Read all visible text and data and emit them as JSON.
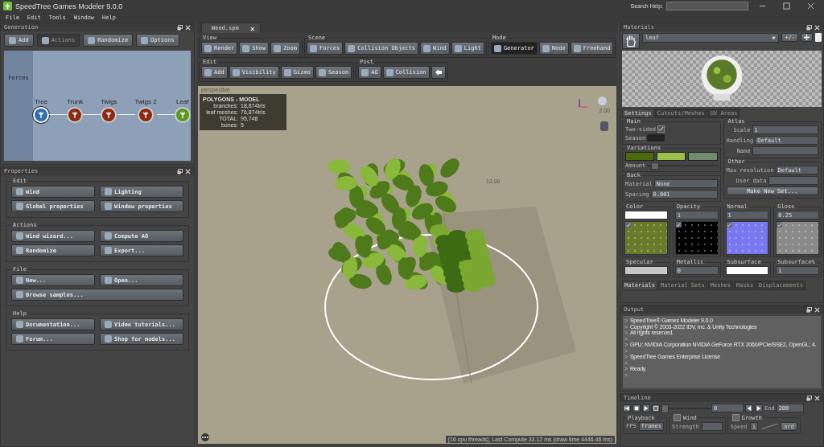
{
  "window": {
    "title": "SpeedTree Games Modeler 9.0.0",
    "search_label": "Search Help:"
  },
  "menu": [
    "File",
    "Edit",
    "Tools",
    "Window",
    "Help"
  ],
  "generation": {
    "title": "Generation",
    "toolbar": [
      {
        "label": "Add",
        "disabled": false
      },
      {
        "label": "Actions",
        "disabled": true
      },
      {
        "label": "Randomize",
        "disabled": false
      },
      {
        "label": "Options",
        "disabled": false
      }
    ],
    "side_label": "Forces",
    "nodes": [
      {
        "label": "Tree",
        "kind": "tree",
        "selected": true
      },
      {
        "label": "Trunk",
        "kind": "branch",
        "selected": false
      },
      {
        "label": "Twigs",
        "kind": "branch",
        "selected": false
      },
      {
        "label": "Twigs 2",
        "kind": "branch",
        "selected": false
      },
      {
        "label": "Leaf",
        "kind": "leaf",
        "selected": false
      }
    ]
  },
  "properties": {
    "title": "Properties",
    "groups": [
      {
        "title": "Edit",
        "buttons": [
          {
            "label": "Wind",
            "wide": false
          },
          {
            "label": "Lighting",
            "wide": false
          },
          {
            "label": "Global properties",
            "wide": false
          },
          {
            "label": "Window properties",
            "wide": false
          }
        ]
      },
      {
        "title": "Actions",
        "buttons": [
          {
            "label": "Wind wizard...",
            "wide": false
          },
          {
            "label": "Compute AO",
            "wide": false
          },
          {
            "label": "Randomize",
            "wide": false
          },
          {
            "label": "Export...",
            "wide": false
          }
        ]
      },
      {
        "title": "File",
        "buttons": [
          {
            "label": "New...",
            "wide": false
          },
          {
            "label": "Open...",
            "wide": false
          },
          {
            "label": "Browse samples...",
            "wide": true
          }
        ]
      },
      {
        "title": "Help",
        "buttons": [
          {
            "label": "Documentation...",
            "wide": false
          },
          {
            "label": "Video tutorials...",
            "wide": false
          },
          {
            "label": "Forum...",
            "wide": false
          },
          {
            "label": "Shop for models...",
            "wide": false
          }
        ]
      }
    ]
  },
  "document_tab": {
    "label": "Weed.spm",
    "close": "✕"
  },
  "toolbar": {
    "rows": [
      [
        {
          "title": "View",
          "buttons": [
            {
              "kind": "label",
              "label": "Render"
            },
            {
              "kind": "label",
              "label": "Show"
            },
            {
              "kind": "label",
              "label": "Zoom"
            }
          ]
        },
        {
          "title": "Scene",
          "buttons": [
            {
              "kind": "label",
              "label": "Forces"
            },
            {
              "kind": "label",
              "label": "Collision Objects"
            },
            {
              "kind": "label",
              "label": "Wind"
            },
            {
              "kind": "label",
              "label": "Light"
            }
          ]
        },
        {
          "title": "Mode",
          "buttons": [
            {
              "kind": "label",
              "label": "Generator",
              "selected": true
            },
            {
              "kind": "label",
              "label": "Node",
              "selected": false
            },
            {
              "kind": "label",
              "label": "Freehand",
              "selected": false
            }
          ]
        }
      ],
      [
        {
          "title": "Edit",
          "buttons": [
            {
              "kind": "label",
              "label": "Add"
            },
            {
              "kind": "label",
              "label": "Visibility"
            },
            {
              "kind": "label",
              "label": "Gizmo"
            },
            {
              "kind": "label",
              "label": "Season"
            }
          ]
        },
        {
          "title": "Post",
          "buttons": [
            {
              "kind": "label",
              "label": "AO"
            },
            {
              "kind": "label",
              "label": "Collision"
            },
            {
              "kind": "arrow"
            }
          ]
        }
      ]
    ]
  },
  "viewport": {
    "label": "perspective",
    "stats": {
      "title": "POLYGONS - MODEL",
      "rows": [
        {
          "label": "branches:",
          "value": "18,874",
          "unit": "tris"
        },
        {
          "label": "leaf meshes:",
          "value": "76,874",
          "unit": "tris"
        },
        {
          "label": "TOTAL:",
          "value": "95,748"
        },
        {
          "label": "bones:",
          "value": "5"
        }
      ]
    },
    "scale_label": "12.00",
    "camera_label": "2.00",
    "status": "[16 cpu threads], Last Compute 33.12 ms (draw time 4446.46 ms)"
  },
  "materials": {
    "title": "Materials",
    "material": "leaf",
    "plus_minus": "+/-",
    "tabs": [
      {
        "label": "Settings",
        "selected": true
      },
      {
        "label": "Cutouts/Meshes",
        "selected": false
      },
      {
        "label": "UV Areas",
        "selected": false
      }
    ],
    "main": {
      "title": "Main",
      "two_sided_label": "Two-sided",
      "two_sided": true,
      "season_label": "Season"
    },
    "variations": {
      "title": "Variations",
      "swatches": [
        {
          "color": "#4a6b0c"
        },
        {
          "color": "#9cc04a"
        },
        {
          "color": "#6f8c6c"
        }
      ],
      "amount_label": "Amount",
      "level": 0.05
    },
    "back": {
      "title": "Back",
      "material_label": "Material",
      "material": "None",
      "spacing_label": "Spacing",
      "spacing": "0.001"
    },
    "atlas": {
      "title": "Atlas",
      "scale_label": "Scale",
      "scale": "1",
      "handling_label": "Handling",
      "handling": "Default",
      "name_label": "Name"
    },
    "other": {
      "title": "Other",
      "max_res_label": "Max resolution",
      "max_res": "Default",
      "user_data_label": "User data",
      "button": "Make New Set..."
    },
    "maps": [
      {
        "title": "Color",
        "kind": "swatch",
        "color": "#ffffff",
        "thumbnail": {
          "color": "#6a7a2a",
          "enabled": true
        }
      },
      {
        "title": "Opacity",
        "kind": "number",
        "value": "1",
        "thumbnail": {
          "color": "#000000",
          "enabled": true
        }
      },
      {
        "title": "Normal",
        "kind": "number",
        "value": "1",
        "thumbnail": {
          "color": "#7a78f0",
          "enabled": true
        }
      },
      {
        "title": "Gloss",
        "kind": "number",
        "value": "0.25",
        "thumbnail": {
          "color": "#8a8a8a",
          "enabled": true
        }
      },
      {
        "title": "Specular",
        "kind": "swatch",
        "color": "#c8c8c8"
      },
      {
        "title": "Metallic",
        "kind": "number",
        "value": "0"
      },
      {
        "title": "Subsurface",
        "kind": "swatch",
        "color": "#ffffff"
      },
      {
        "title": "Subsurface%",
        "kind": "number",
        "value": "1"
      }
    ],
    "bottom_tabs": [
      {
        "label": "Materials",
        "selected": true
      },
      {
        "label": "Material Sets",
        "selected": false
      },
      {
        "label": "Meshes",
        "selected": false
      },
      {
        "label": "Masks",
        "selected": false
      },
      {
        "label": "Displacements",
        "selected": false
      }
    ]
  },
  "output": {
    "title": "Output",
    "prompt": ">",
    "lines": [
      {
        "kind": "text",
        "text": "SpeedTree® Games Modeler 9.0.0"
      },
      {
        "kind": "text",
        "text": "Copyright © 2003-2022 IDV, Inc. & Unity Technologies"
      },
      {
        "kind": "text",
        "text": "All rights reserved."
      },
      {
        "kind": "blank"
      },
      {
        "kind": "text",
        "text": "GPU: NVIDIA Corporation NVIDIA GeForce RTX 2060/PCIe/SSE2, OpenGL: 4."
      },
      {
        "kind": "blank"
      },
      {
        "kind": "text",
        "text": "SpeedTree Games Enterprise License"
      },
      {
        "kind": "blank"
      },
      {
        "kind": "text",
        "text": "Ready."
      },
      {
        "kind": "blank"
      }
    ]
  },
  "timeline": {
    "title": "Timeline",
    "frame": "0",
    "level": 0.0,
    "end_label": "End",
    "end": "200",
    "playback": {
      "title": "Playback",
      "fps_label": "FPS",
      "fps": "frames"
    },
    "wind": {
      "label": "Wind",
      "checked": false,
      "strength_label": "Strength"
    },
    "growth": {
      "label": "Growth",
      "checked": false,
      "speed_label": "Speed",
      "speed": "1",
      "button": "ard"
    }
  }
}
